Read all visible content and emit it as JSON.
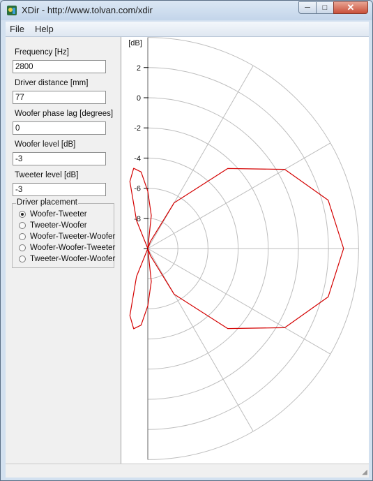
{
  "window": {
    "title": "XDir - http://www.tolvan.com/xdir",
    "min_symbol": "─",
    "max_symbol": "□",
    "close_symbol": "✕"
  },
  "menu": {
    "file": "File",
    "help": "Help"
  },
  "fields": {
    "frequency": {
      "label": "Frequency [Hz]",
      "value": "2800"
    },
    "driver_distance": {
      "label": "Driver distance [mm]",
      "value": "77"
    },
    "woofer_phase_lag": {
      "label": "Woofer phase lag [degrees]",
      "value": "0"
    },
    "woofer_level": {
      "label": "Woofer level [dB]",
      "value": "-3"
    },
    "tweeter_level": {
      "label": "Tweeter level [dB]",
      "value": "-3"
    }
  },
  "placement": {
    "title": "Driver placement",
    "options": [
      "Woofer-Tweeter",
      "Tweeter-Woofer",
      "Woofer-Tweeter-Woofer",
      "Woofer-Woofer-Tweeter",
      "Tweeter-Woofer-Woofer"
    ],
    "selected": 0
  },
  "chart_data": {
    "type": "polar",
    "yunit": "[dB]",
    "rlabels": [
      "2",
      "0",
      "-2",
      "-4",
      "-6",
      "-8"
    ],
    "rlim": [
      -10,
      4
    ],
    "angular_grid_deg": [
      -90,
      -60,
      -30,
      0,
      30,
      60,
      90
    ],
    "grid": true,
    "series": [
      {
        "color": "#d40000",
        "points": [
          [
            0,
            3
          ],
          [
            15,
            2.4
          ],
          [
            30,
            0.5
          ],
          [
            45,
            -2.5
          ],
          [
            60,
            -6.5
          ],
          [
            70,
            -9.5
          ],
          [
            78,
            -10
          ],
          [
            84,
            -7.8
          ],
          [
            90,
            -6.2
          ],
          [
            95,
            -4.9
          ],
          [
            100,
            -4.6
          ],
          [
            105,
            -5.4
          ],
          [
            112,
            -8
          ],
          [
            120,
            -10
          ]
        ]
      }
    ]
  },
  "colors": {
    "trace": "#d40000",
    "grid": "#bdbdbd",
    "axis": "#000000"
  }
}
